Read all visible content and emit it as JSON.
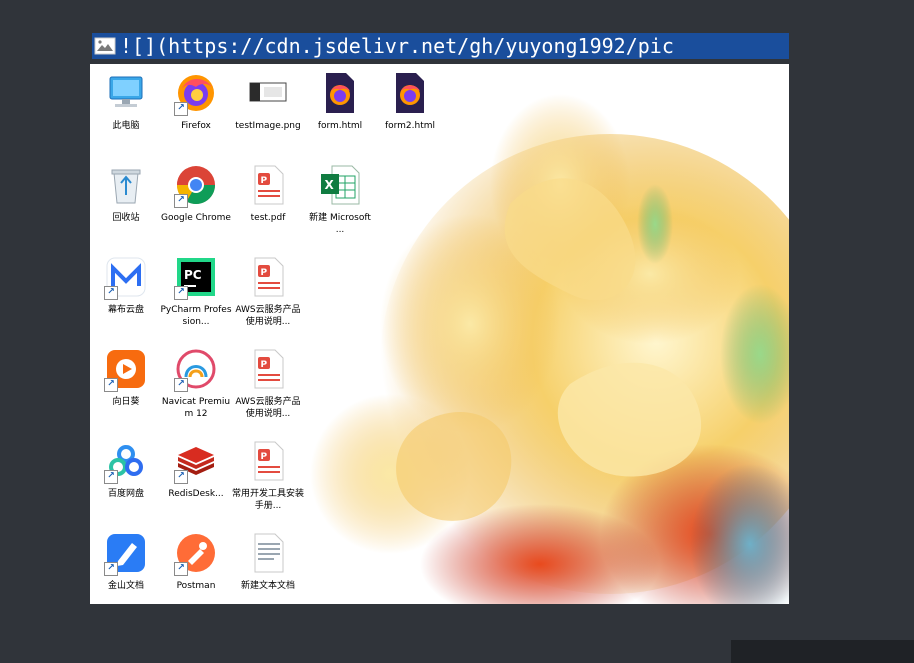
{
  "markdown_line": {
    "text": "![](https://cdn.jsdelivr.net/gh/yuyong1992/pic"
  },
  "desktop": {
    "columns": [
      [
        {
          "label": "此电脑",
          "icon": "computer-icon",
          "shortcut": false
        },
        {
          "label": "回收站",
          "icon": "recycle-bin-icon",
          "shortcut": false
        },
        {
          "label": "幕布云盘",
          "icon": "m-app-icon",
          "shortcut": true
        },
        {
          "label": "向日葵",
          "icon": "sunflower-icon",
          "shortcut": true
        },
        {
          "label": "百度网盘",
          "icon": "baidu-netdisk-icon",
          "shortcut": true
        },
        {
          "label": "金山文档",
          "icon": "pen-app-icon",
          "shortcut": true
        }
      ],
      [
        {
          "label": "Firefox",
          "icon": "firefox-icon",
          "shortcut": true
        },
        {
          "label": "Google Chrome",
          "icon": "chrome-icon",
          "shortcut": true
        },
        {
          "label": "PyCharm Profession...",
          "icon": "pycharm-icon",
          "shortcut": true
        },
        {
          "label": "Navicat Premium 12",
          "icon": "navicat-icon",
          "shortcut": true
        },
        {
          "label": "RedisDesk...",
          "icon": "redis-icon",
          "shortcut": true
        },
        {
          "label": "Postman",
          "icon": "postman-icon",
          "shortcut": true
        }
      ],
      [
        {
          "label": "testImage.png",
          "icon": "image-file-icon",
          "shortcut": false
        },
        {
          "label": "test.pdf",
          "icon": "pdf-file-icon",
          "shortcut": false
        },
        {
          "label": "AWS云服务产品使用说明...",
          "icon": "pdf-file-icon",
          "shortcut": false
        },
        {
          "label": "AWS云服务产品使用说明...",
          "icon": "pdf-file-icon",
          "shortcut": false
        },
        {
          "label": "常用开发工具安装手册...",
          "icon": "pdf-file-icon",
          "shortcut": false
        },
        {
          "label": "新建文本文档",
          "icon": "document-file-icon",
          "shortcut": false
        }
      ],
      [
        {
          "label": "form.html",
          "icon": "firefox-html-icon",
          "shortcut": false
        },
        {
          "label": "新建 Microsoft ...",
          "icon": "excel-icon",
          "shortcut": false
        }
      ],
      [
        {
          "label": "form2.html",
          "icon": "firefox-html-icon",
          "shortcut": false
        }
      ]
    ]
  }
}
